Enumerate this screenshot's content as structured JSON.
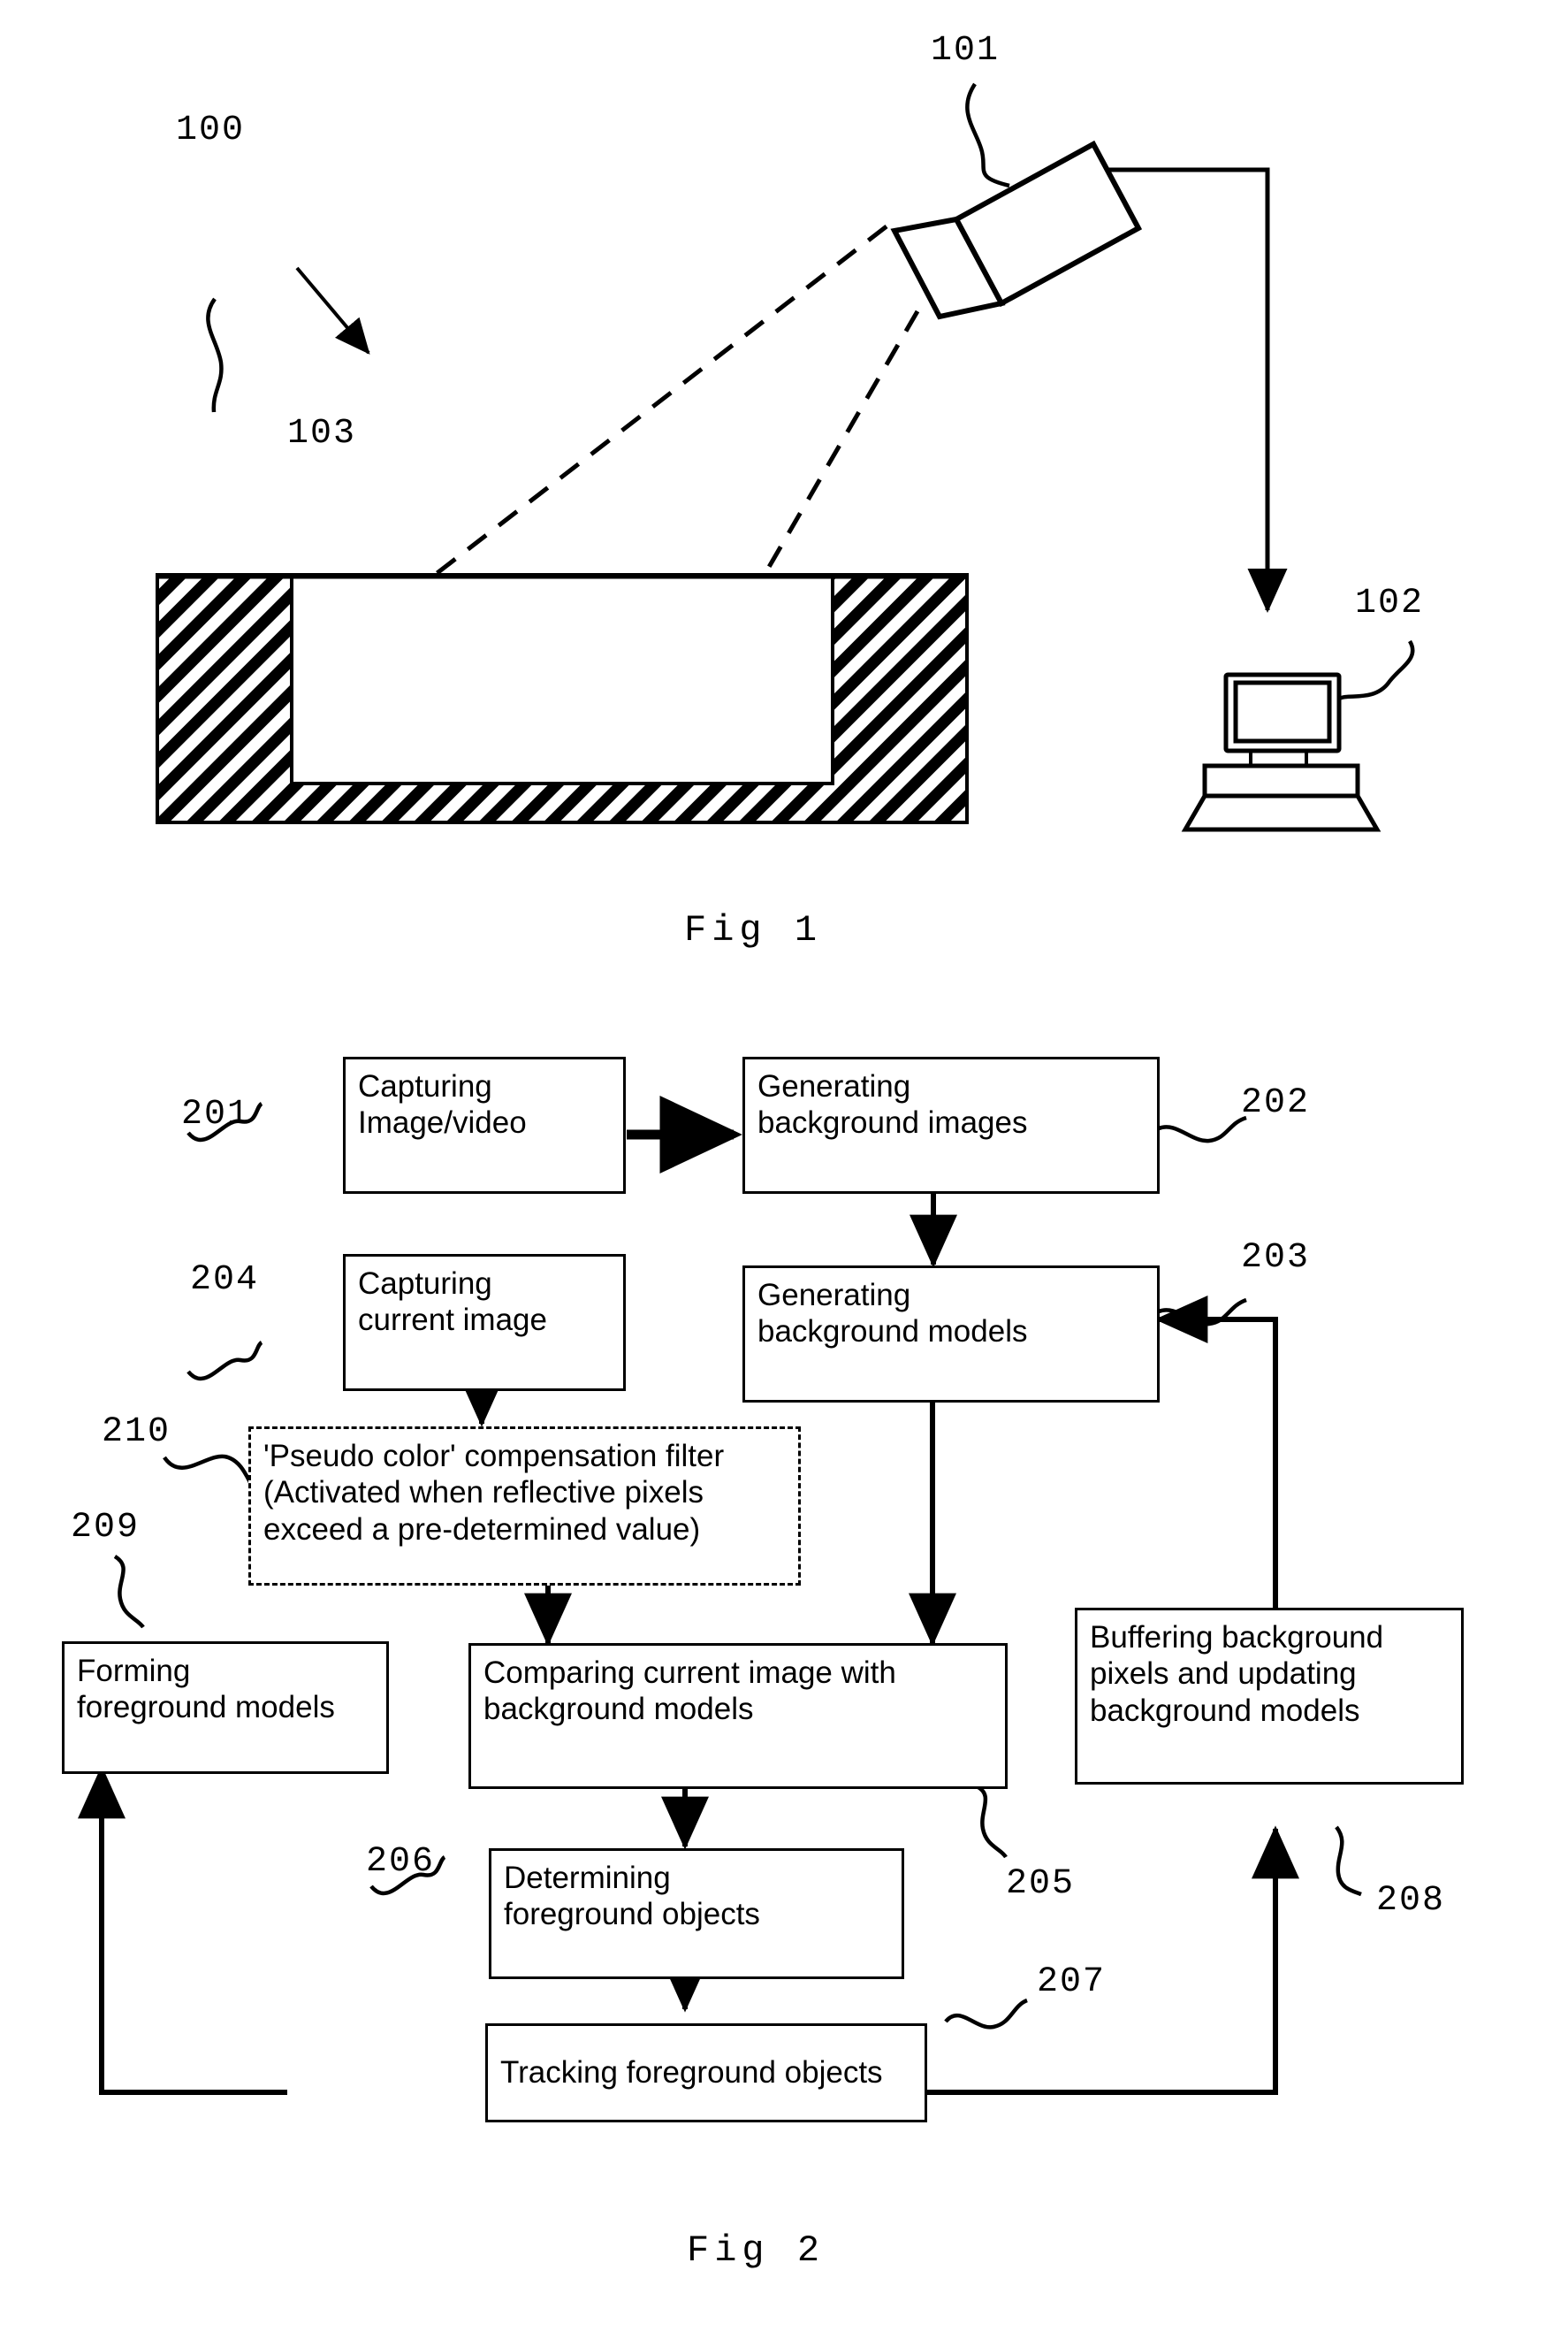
{
  "figures": [
    {
      "id": "fig1",
      "caption": "Fig 1",
      "refs": {
        "system": "100",
        "camera": "101",
        "computer": "102",
        "container": "103"
      },
      "parts": {
        "camera_name": "camera",
        "computer_name": "computer",
        "container_name": "hatched-container",
        "fov_name": "field-of-view"
      }
    },
    {
      "id": "fig2",
      "caption": "Fig 2",
      "steps": [
        {
          "ref": "201",
          "label": "Capturing\nImage/video"
        },
        {
          "ref": "202",
          "label": "Generating\nbackground images"
        },
        {
          "ref": "203",
          "label": "Generating\nbackground models"
        },
        {
          "ref": "204",
          "label": "Capturing\ncurrent image"
        },
        {
          "ref": "205",
          "label": "Comparing current image with\nbackground models"
        },
        {
          "ref": "206",
          "label": "Determining\nforeground objects"
        },
        {
          "ref": "207",
          "label": "Tracking foreground objects"
        },
        {
          "ref": "208",
          "label": "Buffering background\npixels and updating\nbackground models"
        },
        {
          "ref": "209",
          "label": "Forming\nforeground models"
        },
        {
          "ref": "210",
          "label": "'Pseudo color' compensation filter\n(Activated when reflective pixels\nexceed a pre-determined value)"
        }
      ]
    }
  ],
  "colors": {
    "ink": "#000000",
    "paper": "#ffffff"
  }
}
